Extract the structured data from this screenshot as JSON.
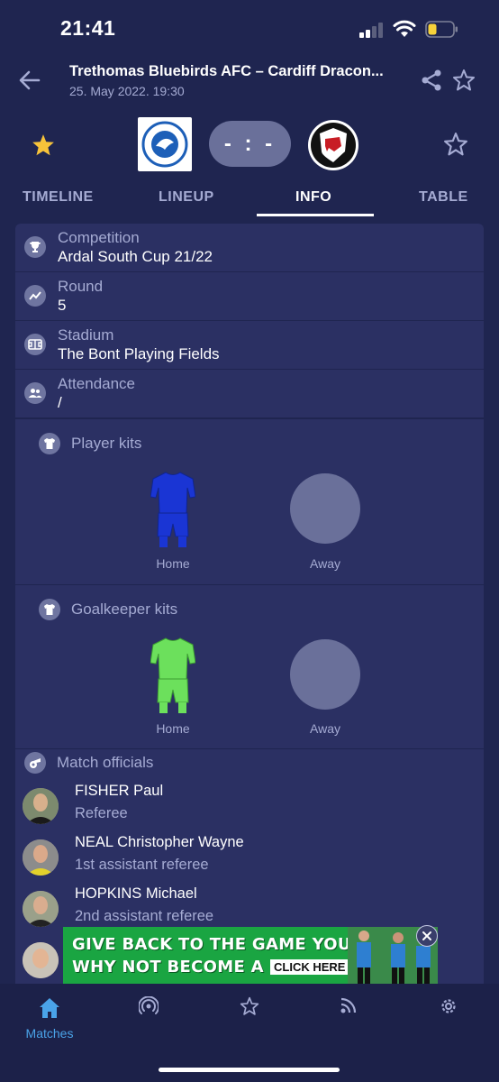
{
  "status_bar": {
    "time": "21:41"
  },
  "header": {
    "title": "Trethomas Bluebirds AFC – Cardiff Dracon...",
    "subtitle": "25. May 2022. 19:30"
  },
  "match": {
    "score": "- : -"
  },
  "tabs": [
    "TIMELINE",
    "LINEUP",
    "INFO",
    "TABLE"
  ],
  "active_tab": "INFO",
  "info": [
    {
      "label": "Competition",
      "value": "Ardal South Cup 21/22",
      "icon": "trophy-icon"
    },
    {
      "label": "Round",
      "value": "5",
      "icon": "trend-icon"
    },
    {
      "label": "Stadium",
      "value": "The Bont Playing Fields",
      "icon": "stadium-icon"
    },
    {
      "label": "Attendance",
      "value": "/",
      "icon": "people-icon"
    }
  ],
  "player_kits": {
    "title": "Player kits",
    "home_label": "Home",
    "away_label": "Away",
    "home_color": "#1a35d4"
  },
  "goalkeeper_kits": {
    "title": "Goalkeeper kits",
    "home_label": "Home",
    "away_label": "Away",
    "home_color": "#6ce05c"
  },
  "officials": {
    "title": "Match officials",
    "list": [
      {
        "name": "FISHER Paul",
        "role": "Referee"
      },
      {
        "name": "NEAL Christopher Wayne",
        "role": "1st assistant referee"
      },
      {
        "name": "HOPKINS Michael",
        "role": "2nd assistant referee"
      }
    ]
  },
  "ad": {
    "line1": "GIVE BACK TO THE GAME YOU LOVE.",
    "line2": "WHY NOT BECOME A REF?",
    "cta": "CLICK HERE"
  },
  "bottom_nav": [
    {
      "label": "Matches",
      "icon": "home-icon",
      "active": true
    },
    {
      "label": "",
      "icon": "live-icon"
    },
    {
      "label": "",
      "icon": "star-icon"
    },
    {
      "label": "",
      "icon": "rss-icon"
    },
    {
      "label": "",
      "icon": "settings-icon"
    }
  ],
  "colors": {
    "background": "#1f2550",
    "card": "#2b3063",
    "accent": "#4aa3e8",
    "muted": "#a5abd3",
    "favorite": "#f7c33a"
  }
}
